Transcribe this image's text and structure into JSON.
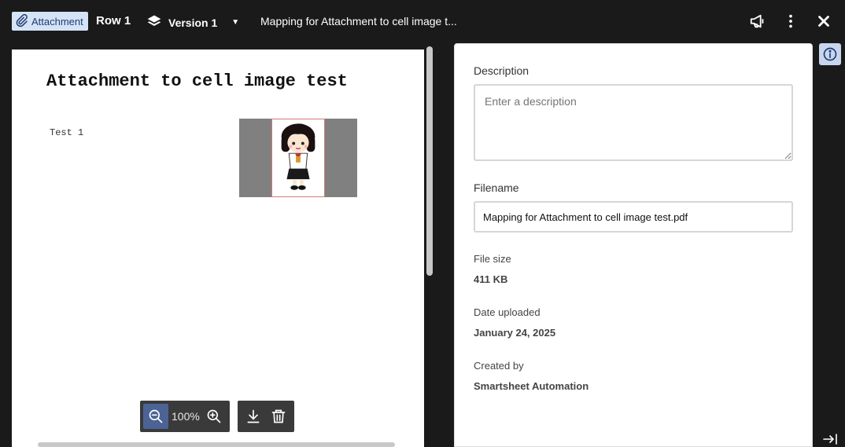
{
  "header": {
    "badge_label": "Attachment",
    "row_title": "Row 1",
    "version_label": "Version 1",
    "document_title": "Mapping for Attachment to cell image t..."
  },
  "document": {
    "title": "Attachment to cell image test",
    "cell_text": "Test 1"
  },
  "viewer_controls": {
    "zoom_level": "100%"
  },
  "details": {
    "description_label": "Description",
    "description_placeholder": "Enter a description",
    "description_value": "",
    "filename_label": "Filename",
    "filename_value": "Mapping for Attachment to cell image test.pdf",
    "file_size_label": "File size",
    "file_size_value": "411 KB",
    "date_uploaded_label": "Date uploaded",
    "date_uploaded_value": "January 24, 2025",
    "created_by_label": "Created by",
    "created_by_value": "Smartsheet Automation"
  },
  "icons": {
    "badge": "paperclip-icon",
    "version": "layers-icon",
    "feedback": "megaphone-icon",
    "more": "more-vertical-icon",
    "close": "close-icon",
    "zoom_out": "zoom-out-icon",
    "zoom_in": "zoom-in-icon",
    "download": "download-icon",
    "delete": "trash-icon",
    "info": "info-icon",
    "collapse": "collapse-panel-icon"
  },
  "colors": {
    "background": "#1a1a1a",
    "badge_bg": "#d5e3f7",
    "active_zoom": "#4c6396",
    "info_bg": "#c7d6ee"
  }
}
